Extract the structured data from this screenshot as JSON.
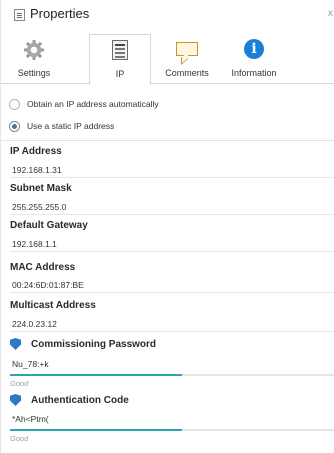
{
  "window": {
    "title": "Properties",
    "close_glyph": "x"
  },
  "tabs": [
    {
      "label": "Settings",
      "icon": "gear-icon"
    },
    {
      "label": "IP",
      "icon": "ip-config-icon"
    },
    {
      "label": "Comments",
      "icon": "comment-icon"
    },
    {
      "label": "Information",
      "icon": "info-icon"
    }
  ],
  "active_tab": "IP",
  "ip_mode": {
    "auto_label": "Obtain an IP address automatically",
    "static_label": "Use a static IP address",
    "selected": "static"
  },
  "fields": {
    "ip_address": {
      "label": "IP Address",
      "value": "192.168.1.31"
    },
    "subnet_mask": {
      "label": "Subnet Mask",
      "value": "255.255.255.0"
    },
    "default_gateway": {
      "label": "Default Gateway",
      "value": "192.168.1.1"
    },
    "mac_address": {
      "label": "MAC Address",
      "value": "00:24:6D:01:87:BE"
    },
    "multicast_address": {
      "label": "Multicast Address",
      "value": "224.0.23.12"
    }
  },
  "commissioning_password": {
    "label": "Commissioning Password",
    "value": "Nu_78:+k",
    "strength_text": "Good",
    "strength": 0.53
  },
  "authentication_code": {
    "label": "Authentication Code",
    "value": "*Ah<Ptm(",
    "strength_text": "Good",
    "strength": 0.53
  },
  "colors": {
    "shield": "#2f78c4",
    "strength_fill": "#2aa6b0",
    "info_icon": "#1c7fd6"
  }
}
